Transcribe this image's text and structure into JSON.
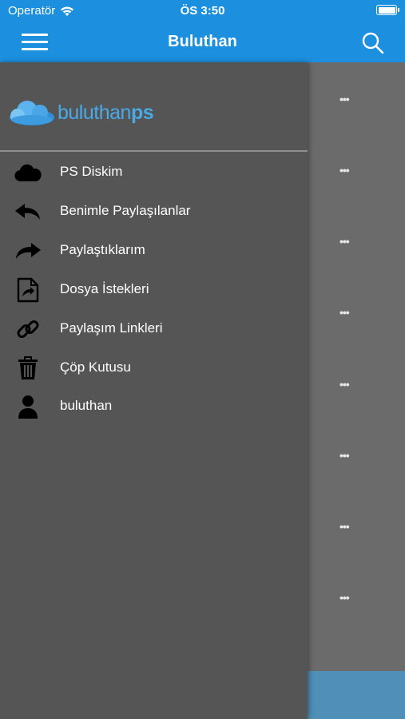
{
  "status_bar": {
    "carrier": "Operatör",
    "time": "ÖS 3:50"
  },
  "header": {
    "title": "Buluthan"
  },
  "drawer": {
    "logo": {
      "text_main": "buluthan",
      "text_accent": "ps"
    },
    "items": [
      {
        "label": "PS Diskim",
        "icon": "cloud-icon"
      },
      {
        "label": "Benimle Paylaşılanlar",
        "icon": "reply-icon"
      },
      {
        "label": "Paylaştıklarım",
        "icon": "share-icon"
      },
      {
        "label": "Dosya İstekleri",
        "icon": "file-share-icon"
      },
      {
        "label": "Paylaşım Linkleri",
        "icon": "link-icon"
      },
      {
        "label": "Çöp Kutusu",
        "icon": "trash-icon"
      },
      {
        "label": "buluthan",
        "icon": "user-icon"
      }
    ]
  },
  "list": {
    "more_label": "•••"
  },
  "colors": {
    "accent": "#1c8fde",
    "drawer_bg": "#555555",
    "logo": "#4aa9e8"
  }
}
